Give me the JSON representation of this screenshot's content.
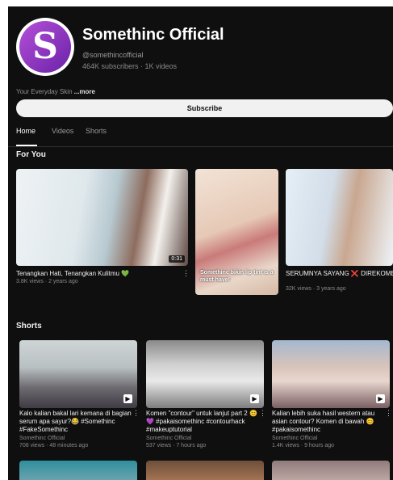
{
  "channel": {
    "name": "Somethinc Official",
    "avatar_letter": "S",
    "handle": "@somethincofficial",
    "meta": "464K subscribers · 1K videos",
    "description_prefix": "Your Everyday Skin ",
    "description_more": "...more",
    "subscribe_label": "Subscribe"
  },
  "tabs": [
    {
      "label": "Home",
      "active": true
    },
    {
      "label": "Videos",
      "active": false
    },
    {
      "label": "Shorts",
      "active": false
    }
  ],
  "for_you": {
    "title": "For You",
    "videos": [
      {
        "title": "Tenangkan Hati, Tenangkan Kulitmu 💚",
        "meta": "3.8K views · 2 years ago",
        "duration": "0:31"
      },
      {
        "title": "",
        "overlay": "Somethinc bikin lip tint is a must have!",
        "meta": ""
      },
      {
        "title": "SERUMNYA SAYANG ❌ DIREKOMEN",
        "meta": "32K views · 3 years ago"
      }
    ]
  },
  "shorts": {
    "title": "Shorts",
    "items": [
      {
        "title": "Kalo kalian bakal lari kemana di bagian serum apa sayur?😂 #Somethinc #FakeSomethinc",
        "channel": "Somethinc Official",
        "meta": "708 views · 48 minutes ago"
      },
      {
        "title": "Komen \"contour\" untuk lanjut part 2 😊💜 #pakaisomethinc #contourhack #makeuptutorial",
        "channel": "Somethinc Official",
        "meta": "537 views · 7 hours ago"
      },
      {
        "title": "Kalian lebih suka hasil western atau asian contour? Komen di bawah 😊 #pakaisomethinc",
        "channel": "Somethinc Official",
        "meta": "1.4K views · 9 hours ago"
      }
    ]
  },
  "colors": {
    "background": "#0f0f0f",
    "text": "#f1f1f1",
    "muted": "#8a8a8a",
    "brand": "#9b3fd0"
  }
}
